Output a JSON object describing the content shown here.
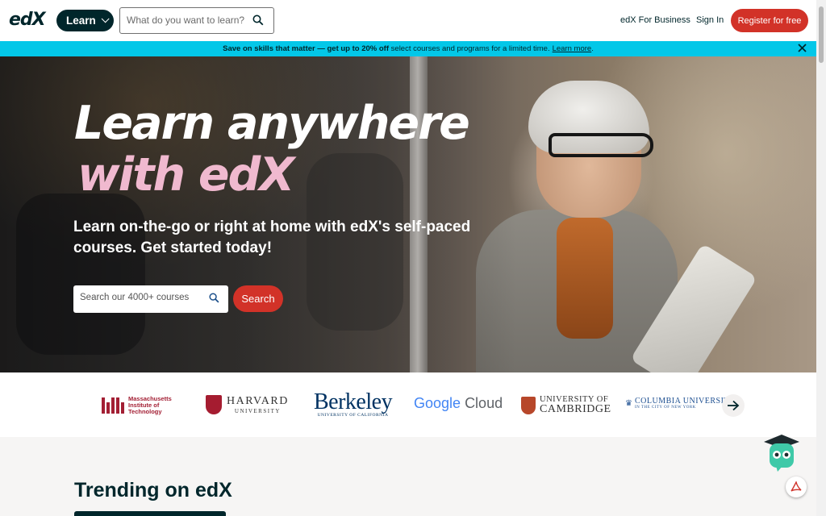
{
  "header": {
    "logo_text": "edX",
    "learn_label": "Learn",
    "search_placeholder": "What do you want to learn?",
    "business_link": "edX For Business",
    "signin_link": "Sign In",
    "register_label": "Register for free"
  },
  "promo": {
    "bold_text": "Save on skills that matter — get up to 20% off",
    "rest_text": "select courses and programs for a limited time.",
    "link_text": "Learn more",
    "link_suffix": ".",
    "bg_color": "#03c7e8"
  },
  "hero": {
    "title_line1": "Learn anywhere",
    "title_line2": "with edX",
    "subtitle": "Learn on-the-go or right at home with edX's self-paced courses. Get started today!",
    "search_placeholder": "Search our 4000+ courses",
    "search_button": "Search",
    "accent_color": "#f0b9cf"
  },
  "partners": {
    "mit_line1": "Massachusetts",
    "mit_line2": "Institute of",
    "mit_line3": "Technology",
    "harvard_line1": "HARVARD",
    "harvard_line2": "UNIVERSITY",
    "berkeley_line1": "Berkeley",
    "berkeley_line2": "UNIVERSITY OF CALIFORNIA",
    "google_word": "Google",
    "google_cloud": "Cloud",
    "cambridge_line1": "UNIVERSITY OF",
    "cambridge_line2": "CAMBRIDGE",
    "columbia_line1": "COLUMBIA UNIVERSITY",
    "columbia_line2": "IN THE CITY OF NEW YORK"
  },
  "trending": {
    "title": "Trending on edX"
  },
  "colors": {
    "brand_dark": "#00262b",
    "brand_red": "#d23228",
    "cyan": "#03c7e8"
  },
  "icons": [
    "search-icon",
    "chevron-down-icon",
    "close-icon",
    "arrow-right-icon",
    "chatbot-icon",
    "pdf-icon"
  ]
}
